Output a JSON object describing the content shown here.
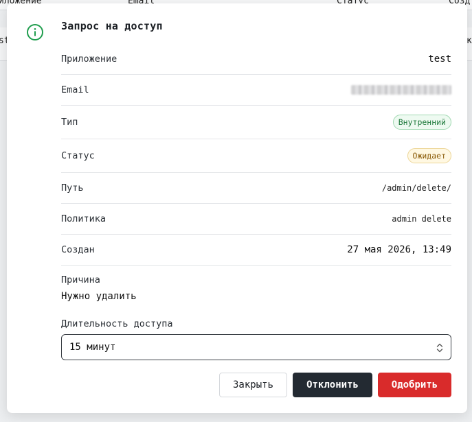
{
  "background": {
    "header_cells": [
      "иложение",
      "Email",
      "Статус",
      "Созд"
    ],
    "row_cells": [
      "st",
      "к"
    ]
  },
  "modal": {
    "title": "Запрос на доступ",
    "icon": "info-circle-icon",
    "accent_color": "#1f9d4d",
    "details": [
      {
        "label": "Приложение",
        "value": "test"
      },
      {
        "label": "Email",
        "value": ""
      },
      {
        "label": "Тип",
        "value": "Внутренний"
      },
      {
        "label": "Статус",
        "value": "Ожидает"
      },
      {
        "label": "Путь",
        "value": "/admin/delete/"
      },
      {
        "label": "Политика",
        "value": "admin delete"
      },
      {
        "label": "Создан",
        "value": "27 мая 2026, 13:49"
      }
    ],
    "reason": {
      "label": "Причина",
      "value": "Нужно удалить"
    },
    "duration": {
      "label": "Длительность доступа",
      "selected": "15 минут"
    },
    "buttons": {
      "close": "Закрыть",
      "reject": "Отклонить",
      "approve": "Одобрить"
    },
    "colors": {
      "reject_bg": "#232a32",
      "approve_bg": "#d92b2b"
    }
  }
}
